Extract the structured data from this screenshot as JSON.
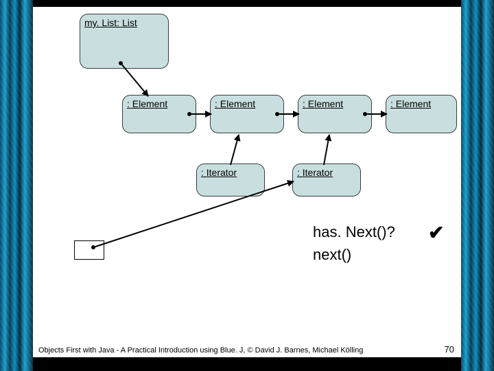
{
  "list": {
    "label": "my. List: List"
  },
  "elements": [
    {
      "label": ": Element"
    },
    {
      "label": ": Element"
    },
    {
      "label": ": Element"
    },
    {
      "label": ": Element"
    }
  ],
  "iterators": [
    {
      "label": ": Iterator"
    },
    {
      "label": ": Iterator"
    }
  ],
  "calls": {
    "hasNext": "has. Next()?",
    "next": "next()"
  },
  "checkmark": "✔",
  "footer": "Objects First with Java - A Practical Introduction using Blue. J, © David J. Barnes, Michael Kölling",
  "page": "70"
}
